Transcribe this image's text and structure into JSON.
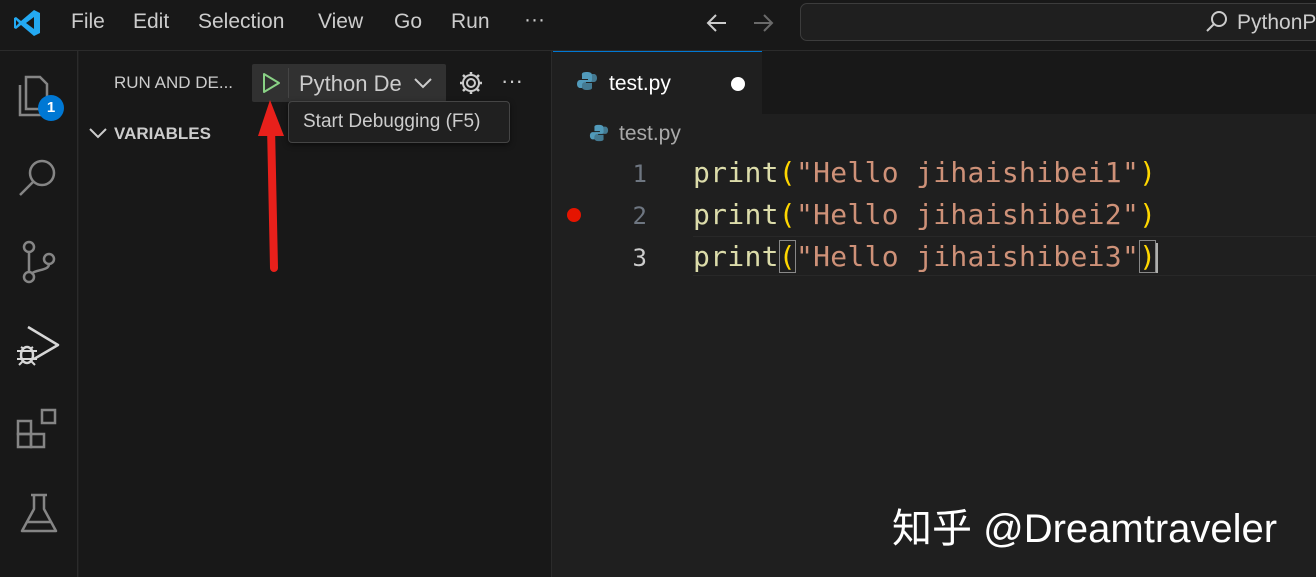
{
  "menu": {
    "items": [
      "File",
      "Edit",
      "Selection",
      "View",
      "Go",
      "Run"
    ],
    "more": "···"
  },
  "search": {
    "text": "PythonPr"
  },
  "activity": {
    "explorer_badge": "1"
  },
  "sidebar": {
    "header": "RUN AND DE...",
    "config_label": "Python De",
    "tooltip": "Start Debugging (F5)",
    "variables_label": "VARIABLES"
  },
  "editor": {
    "tab_label": "test.py",
    "breadcrumb": "test.py",
    "lines": [
      {
        "number": "1",
        "fn": "print",
        "open": "(",
        "str": "\"Hello jihaishibei1\"",
        "close": ")",
        "breakpoint": false
      },
      {
        "number": "2",
        "fn": "print",
        "open": "(",
        "str": "\"Hello jihaishibei2\"",
        "close": ")",
        "breakpoint": true
      },
      {
        "number": "3",
        "fn": "print",
        "open": "(",
        "str": "\"Hello jihaishibei3\"",
        "close": ")",
        "breakpoint": false
      }
    ]
  },
  "watermark": "知乎 @Dreamtraveler",
  "colors": {
    "accent": "#0078d4",
    "badge": "#0078d4",
    "breakpoint": "#e51400",
    "arrow": "#e8201b",
    "play": "#89d185"
  }
}
